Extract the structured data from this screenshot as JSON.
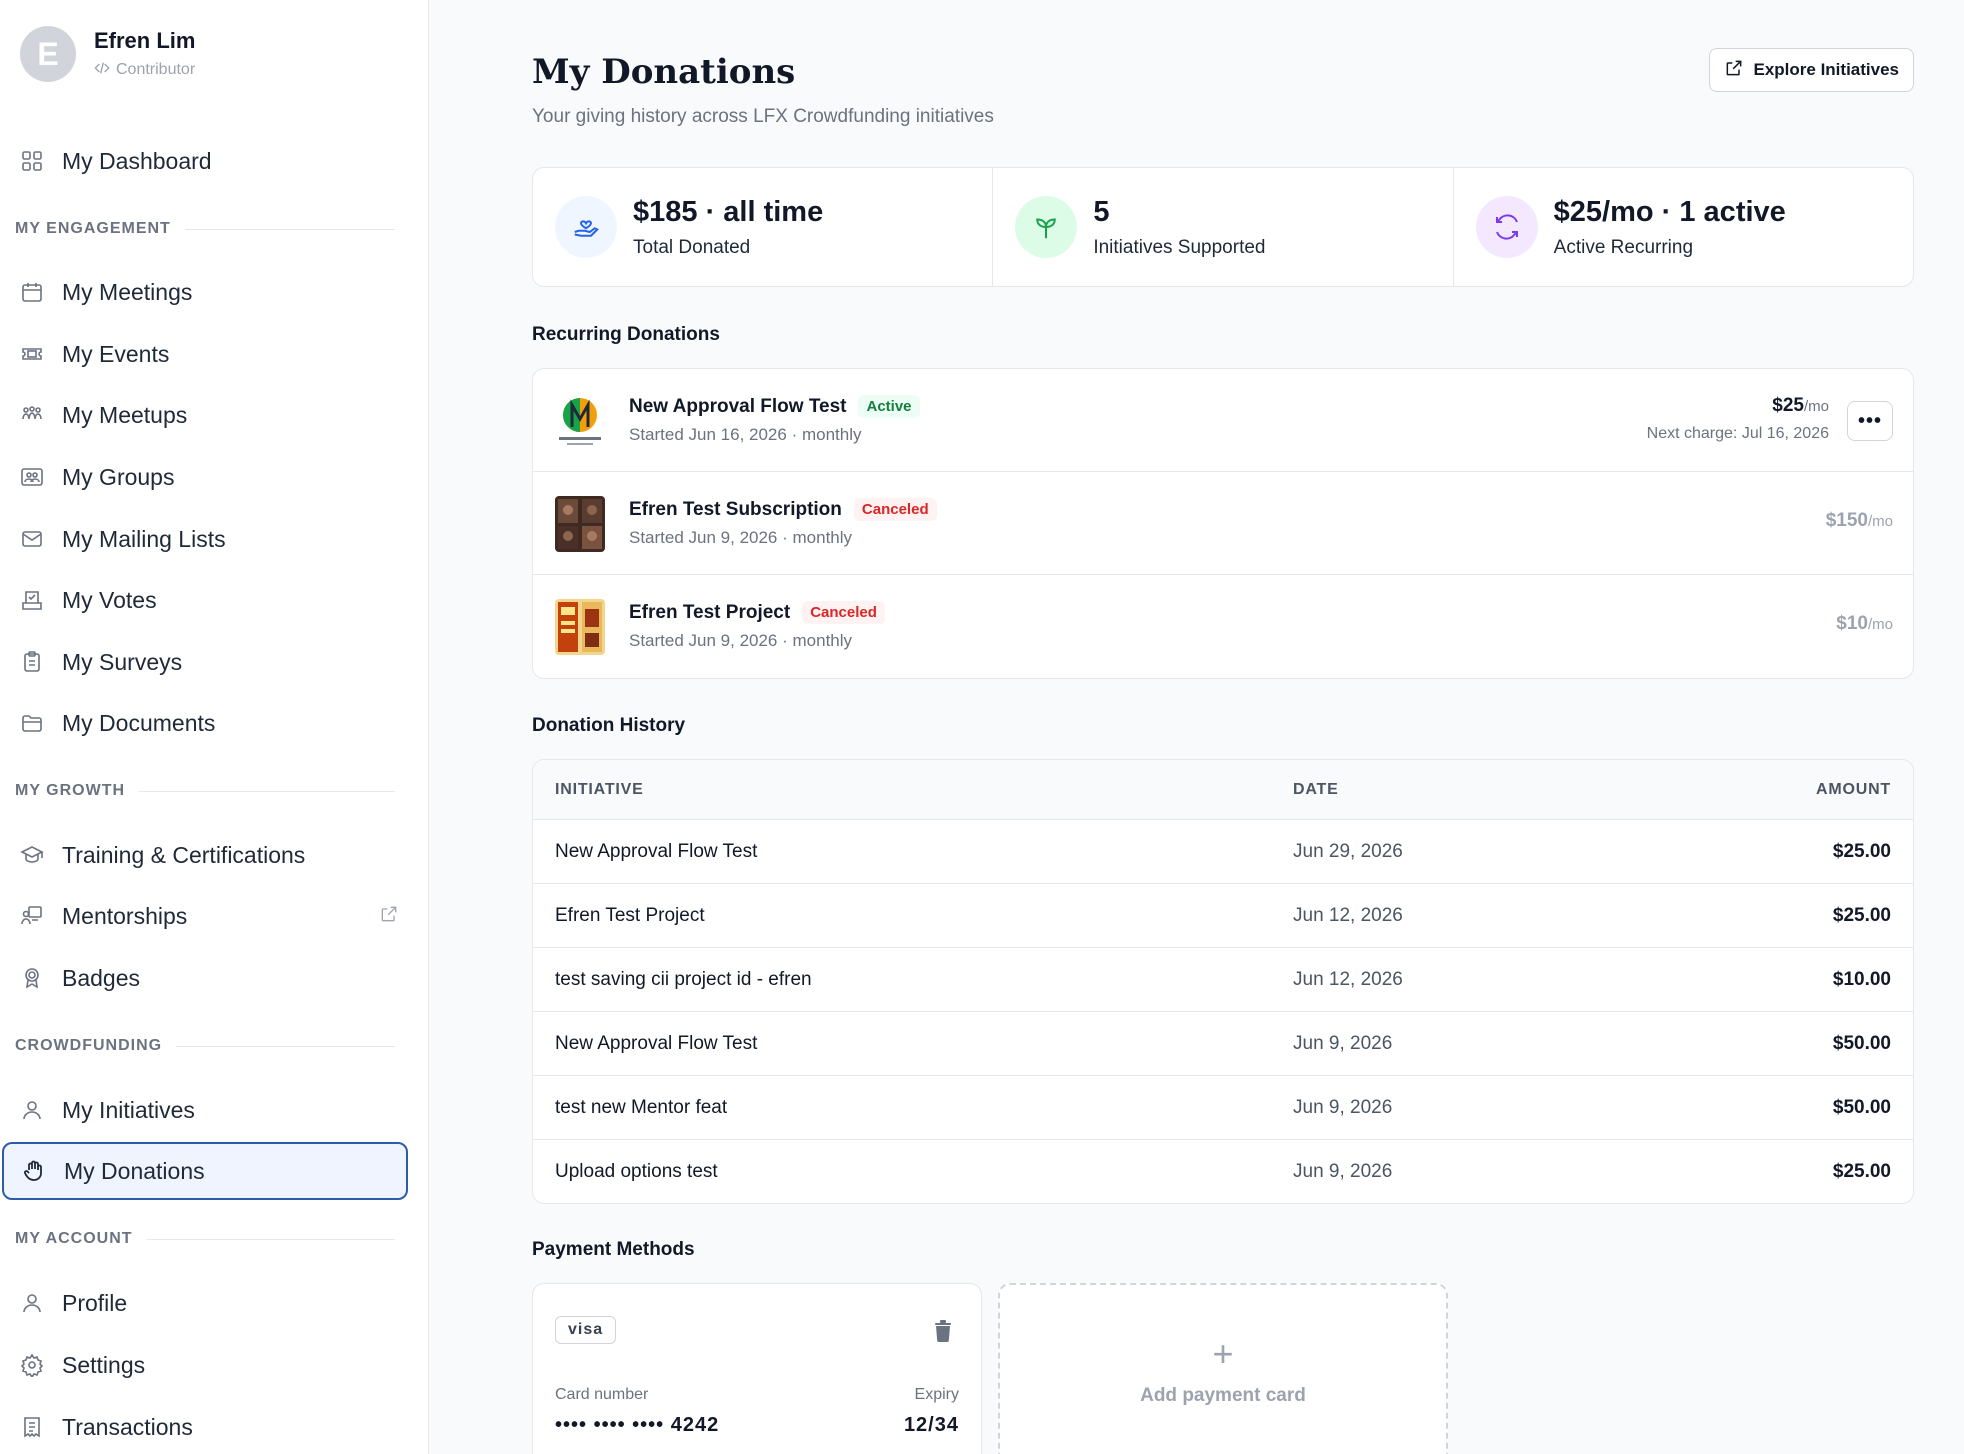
{
  "user": {
    "initial": "E",
    "name": "Efren Lim",
    "role": "Contributor"
  },
  "sidebar": {
    "dashboard": "My Dashboard",
    "sections": {
      "engagement": "MY ENGAGEMENT",
      "growth": "MY GROWTH",
      "crowdfunding": "CROWDFUNDING",
      "account": "MY ACCOUNT"
    },
    "items": {
      "meetings": "My Meetings",
      "events": "My Events",
      "meetups": "My Meetups",
      "groups": "My Groups",
      "mailing": "My Mailing Lists",
      "votes": "My Votes",
      "surveys": "My Surveys",
      "documents": "My Documents",
      "training": "Training & Certifications",
      "mentorships": "Mentorships",
      "badges": "Badges",
      "initiatives": "My Initiatives",
      "donations": "My Donations",
      "profile": "Profile",
      "settings": "Settings",
      "transactions": "Transactions"
    }
  },
  "header": {
    "title": "My Donations",
    "subtitle": "Your giving history across LFX Crowdfunding initiatives",
    "explore_label": "Explore Initiatives"
  },
  "stats": [
    {
      "value": "$185 · all time",
      "label": "Total Donated",
      "icon": "hand-heart-icon"
    },
    {
      "value": "5",
      "label": "Initiatives Supported",
      "icon": "sprout-icon"
    },
    {
      "value": "$25/mo · 1 active",
      "label": "Active Recurring",
      "icon": "refresh-icon"
    }
  ],
  "recurring": {
    "title": "Recurring Donations",
    "rows": [
      {
        "name": "New Approval Flow Test",
        "status": "Active",
        "started": "Started Jun 16, 2026 · monthly",
        "amount": "$25",
        "per": "/mo",
        "next": "Next charge: Jul 16, 2026"
      },
      {
        "name": "Efren Test Subscription",
        "status": "Canceled",
        "started": "Started Jun 9, 2026 · monthly",
        "amount": "$150",
        "per": "/mo"
      },
      {
        "name": "Efren Test Project",
        "status": "Canceled",
        "started": "Started Jun 9, 2026 · monthly",
        "amount": "$10",
        "per": "/mo"
      }
    ]
  },
  "history": {
    "title": "Donation History",
    "columns": {
      "initiative": "INITIATIVE",
      "date": "DATE",
      "amount": "AMOUNT"
    },
    "rows": [
      {
        "initiative": "New Approval Flow Test",
        "date": "Jun 29, 2026",
        "amount": "$25.00"
      },
      {
        "initiative": "Efren Test Project",
        "date": "Jun 12, 2026",
        "amount": "$25.00"
      },
      {
        "initiative": "test saving cii project id - efren",
        "date": "Jun 12, 2026",
        "amount": "$10.00"
      },
      {
        "initiative": "New Approval Flow Test",
        "date": "Jun 9, 2026",
        "amount": "$50.00"
      },
      {
        "initiative": "test new Mentor feat",
        "date": "Jun 9, 2026",
        "amount": "$50.00"
      },
      {
        "initiative": "Upload options test",
        "date": "Jun 9, 2026",
        "amount": "$25.00"
      }
    ]
  },
  "payment": {
    "title": "Payment Methods",
    "brand": "visa",
    "card_label": "Card number",
    "card_number": "•••• •••• •••• 4242",
    "expiry_label": "Expiry",
    "expiry": "12/34",
    "add_plus": "+",
    "add_label": "Add payment card"
  },
  "colors": {
    "accent": "#2f5ba8",
    "active_bg": "#eff4ff",
    "success": "#15803d",
    "danger": "#dc2626"
  }
}
